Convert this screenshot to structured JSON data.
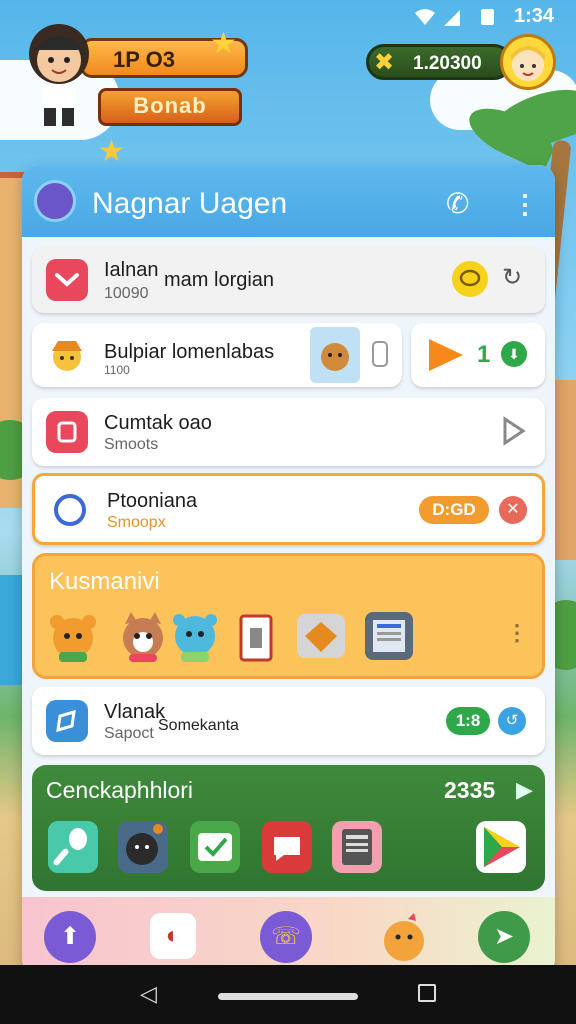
{
  "status_bar": {
    "time": "1:34"
  },
  "hud": {
    "level_label": "1P O3",
    "game_logo": "Bonab",
    "coins": "1.20300"
  },
  "panel": {
    "title": "Nagnar Uagen",
    "rows": [
      {
        "title": "Ialnan",
        "subtitle": "10090",
        "extra": "mam lorgian"
      },
      {
        "title": "Bulpiar lomenlabas",
        "subtitle": "1100",
        "side_count": "1"
      },
      {
        "title": "Cumtak oao",
        "subtitle": "Smoots"
      },
      {
        "title": "Ptooniana",
        "subtitle": "Smoopx",
        "badge": "D:GD"
      },
      {
        "title": "Vlanak",
        "subtitle": "Sapoct",
        "extra": "Somekanta",
        "badge": "1:8"
      }
    ],
    "collection": {
      "title": "Kusmanivi"
    },
    "green_section": {
      "title": "Cenckaphhlori",
      "count": "2335"
    }
  },
  "colors": {
    "header_blue": "#4aa7e3",
    "collection_orange": "#fcc35a",
    "green_section": "#2f7530"
  }
}
